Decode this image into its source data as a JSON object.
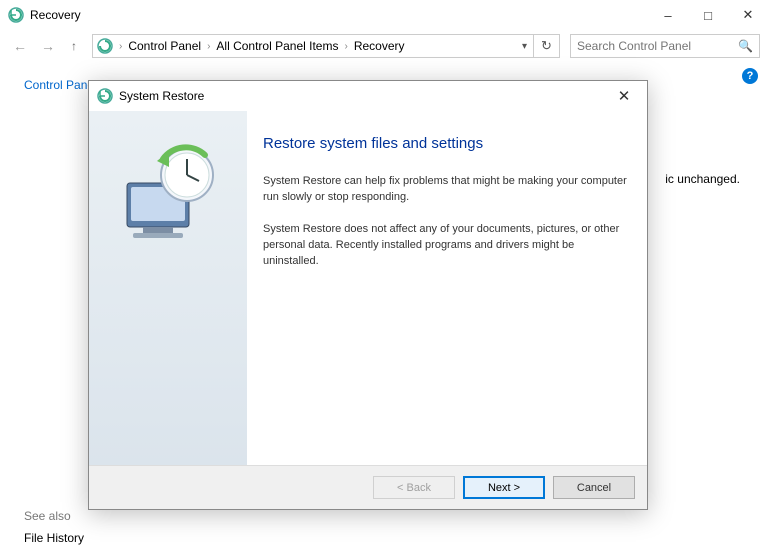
{
  "window": {
    "title": "Recovery"
  },
  "breadcrumb": {
    "items": [
      "Control Panel",
      "All Control Panel Items",
      "Recovery"
    ]
  },
  "search": {
    "placeholder": "Search Control Panel"
  },
  "sidebar": {
    "home": "Control Panel Home",
    "seealso": "See also",
    "filehistory": "File History"
  },
  "background": {
    "partial_text": "ic unchanged."
  },
  "dialog": {
    "title": "System Restore",
    "heading": "Restore system files and settings",
    "para1": "System Restore can help fix problems that might be making your computer run slowly or stop responding.",
    "para2": "System Restore does not affect any of your documents, pictures, or other personal data. Recently installed programs and drivers might be uninstalled.",
    "buttons": {
      "back": "< Back",
      "next": "Next >",
      "cancel": "Cancel"
    }
  }
}
